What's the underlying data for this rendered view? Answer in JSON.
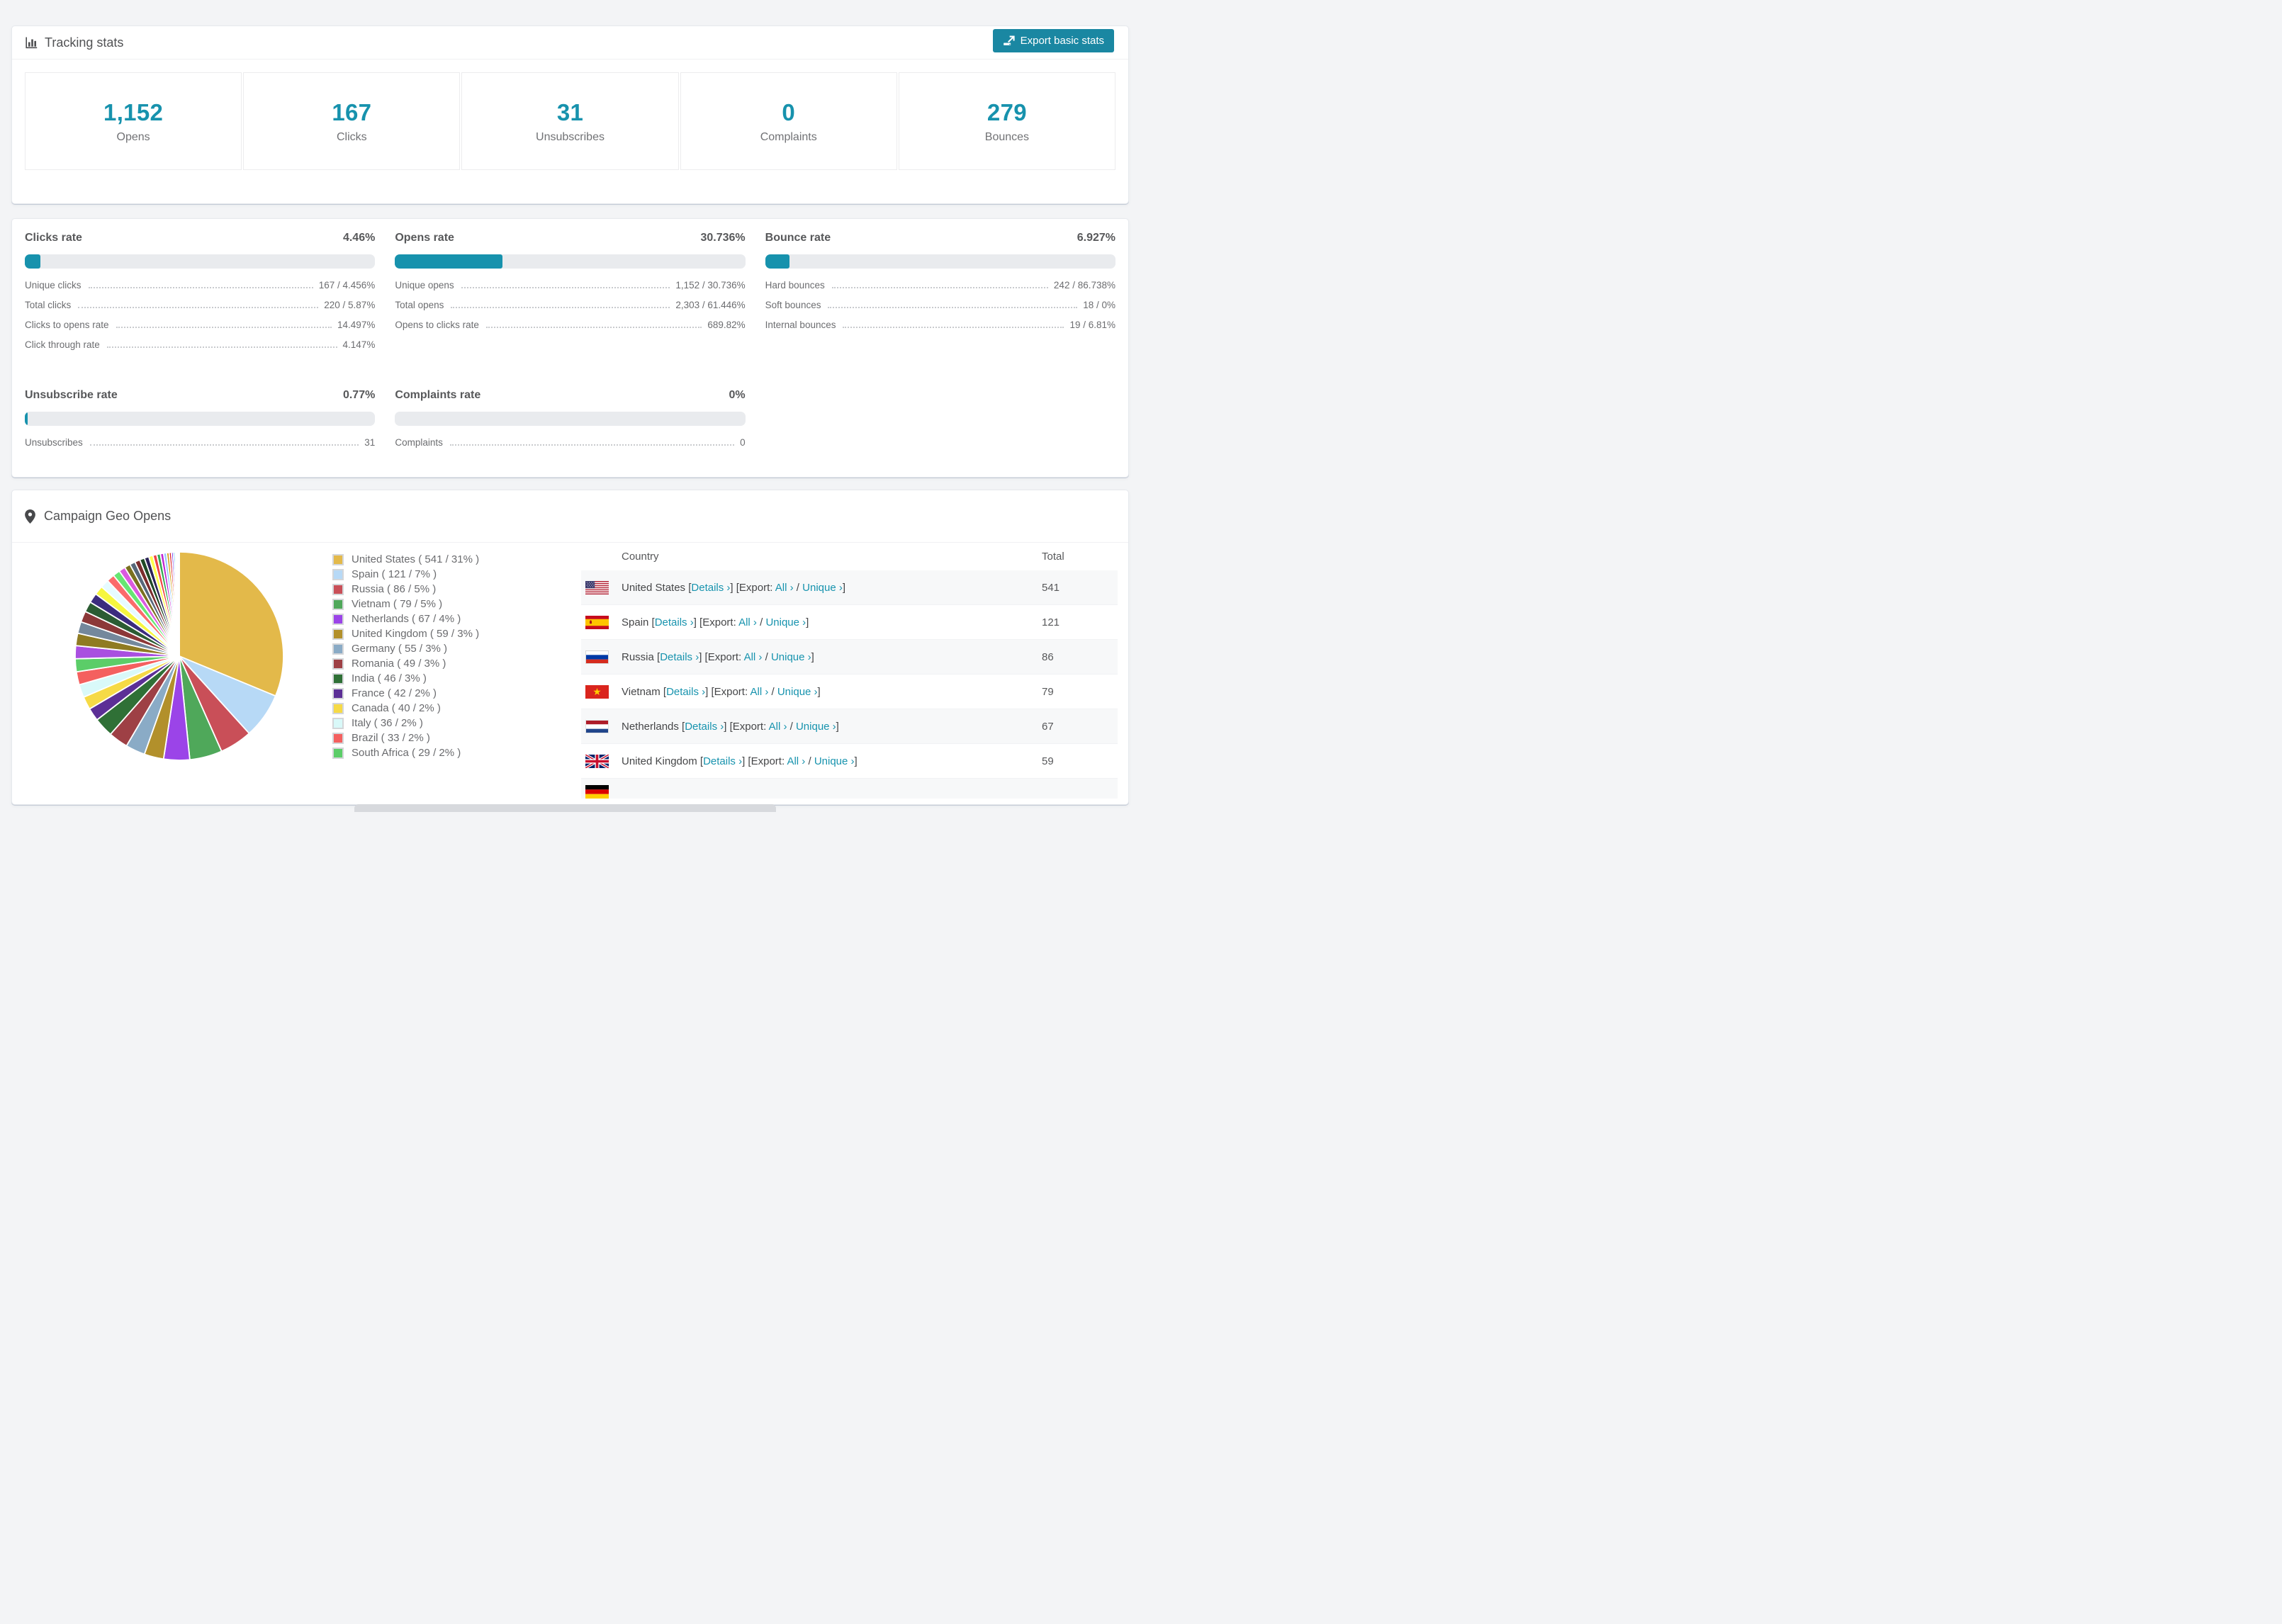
{
  "header": {
    "title": "Tracking stats",
    "export_button": "Export basic stats"
  },
  "stats": [
    {
      "value": "1,152",
      "label": "Opens"
    },
    {
      "value": "167",
      "label": "Clicks"
    },
    {
      "value": "31",
      "label": "Unsubscribes"
    },
    {
      "value": "0",
      "label": "Complaints"
    },
    {
      "value": "279",
      "label": "Bounces"
    }
  ],
  "rates": {
    "clicks": {
      "title": "Clicks rate",
      "value": "4.46%",
      "bar_pct": 4.46,
      "items": [
        [
          "Unique clicks",
          "167 / 4.456%"
        ],
        [
          "Total clicks",
          "220 / 5.87%"
        ],
        [
          "Clicks to opens rate",
          "14.497%"
        ],
        [
          "Click through rate",
          "4.147%"
        ]
      ]
    },
    "opens": {
      "title": "Opens rate",
      "value": "30.736%",
      "bar_pct": 30.736,
      "items": [
        [
          "Unique opens",
          "1,152 / 30.736%"
        ],
        [
          "Total opens",
          "2,303 / 61.446%"
        ],
        [
          "Opens to clicks rate",
          "689.82%"
        ]
      ]
    },
    "bounce": {
      "title": "Bounce rate",
      "value": "6.927%",
      "bar_pct": 6.927,
      "items": [
        [
          "Hard bounces",
          "242 / 86.738%"
        ],
        [
          "Soft bounces",
          "18 / 0%"
        ],
        [
          "Internal bounces",
          "19 / 6.81%"
        ]
      ]
    },
    "unsubscribe": {
      "title": "Unsubscribe rate",
      "value": "0.77%",
      "bar_pct": 0.77,
      "items": [
        [
          "Unsubscribes",
          "31"
        ]
      ]
    },
    "complaints": {
      "title": "Complaints rate",
      "value": "0%",
      "bar_pct": 0,
      "items": [
        [
          "Complaints",
          "0"
        ]
      ]
    }
  },
  "geo": {
    "title": "Campaign Geo Opens",
    "table": {
      "columns": [
        "Country",
        "Total"
      ],
      "link_labels": {
        "details": "Details ›",
        "export": "Export:",
        "all": "All ›",
        "unique": "Unique ›"
      },
      "rows": [
        {
          "flag": "us",
          "country": "United States",
          "total": "541"
        },
        {
          "flag": "es",
          "country": "Spain",
          "total": "121"
        },
        {
          "flag": "ru",
          "country": "Russia",
          "total": "86"
        },
        {
          "flag": "vn",
          "country": "Vietnam",
          "total": "79"
        },
        {
          "flag": "nl",
          "country": "Netherlands",
          "total": "67"
        },
        {
          "flag": "gb",
          "country": "United Kingdom",
          "total": "59"
        },
        {
          "flag": "de",
          "country": "",
          "total": "",
          "partial": true
        }
      ]
    }
  },
  "chart_data": {
    "type": "pie",
    "title": "Campaign Geo Opens",
    "legend_position": "right",
    "slices": [
      {
        "label": "United States",
        "count": 541,
        "pct": 31,
        "color": "#e3b94a"
      },
      {
        "label": "Spain",
        "count": 121,
        "pct": 7,
        "color": "#b7d9f6"
      },
      {
        "label": "Russia",
        "count": 86,
        "pct": 5,
        "color": "#c94f58"
      },
      {
        "label": "Vietnam",
        "count": 79,
        "pct": 5,
        "color": "#4fa85a"
      },
      {
        "label": "Netherlands",
        "count": 67,
        "pct": 4,
        "color": "#9b44e8"
      },
      {
        "label": "United Kingdom",
        "count": 59,
        "pct": 3,
        "color": "#b2902b"
      },
      {
        "label": "Germany",
        "count": 55,
        "pct": 3,
        "color": "#8aabc6"
      },
      {
        "label": "Romania",
        "count": 49,
        "pct": 3,
        "color": "#9e4045"
      },
      {
        "label": "India",
        "count": 46,
        "pct": 3,
        "color": "#2f7036"
      },
      {
        "label": "France",
        "count": 42,
        "pct": 2,
        "color": "#5c2f96"
      },
      {
        "label": "Canada",
        "count": 40,
        "pct": 2,
        "color": "#f6da46"
      },
      {
        "label": "Italy",
        "count": 36,
        "pct": 2,
        "color": "#d9f9f9"
      },
      {
        "label": "Brazil",
        "count": 33,
        "pct": 2,
        "color": "#f4605f"
      },
      {
        "label": "South Africa",
        "count": 29,
        "pct": 2,
        "color": "#5bcd68"
      }
    ],
    "small_unlabeled_slices": {
      "values": [
        2.0,
        1.9,
        1.8,
        1.7,
        1.6,
        1.5,
        1.4,
        1.3,
        1.2,
        1.1,
        1.0,
        0.9,
        0.85,
        0.8,
        0.75,
        0.7,
        0.65,
        0.6,
        0.55,
        0.5,
        0.45,
        0.4,
        0.35,
        0.3,
        0.25,
        0.2,
        0.15,
        0.12,
        0.1,
        0.08
      ],
      "colors": [
        "#a94fe0",
        "#8f7b22",
        "#74889c",
        "#8c3838",
        "#2b5c33",
        "#3b2c7e",
        "#f6f63f",
        "#e6fbff",
        "#fb6b6b",
        "#66e673",
        "#da5be0",
        "#7a701f",
        "#56687a",
        "#7b2d2d",
        "#1f4a26",
        "#2b2357",
        "#ffff4d",
        "#ef4444",
        "#34a853",
        "#c026d3",
        "#93c5fd",
        "#d4a017",
        "#dc2626",
        "#7c3aed",
        "#0ea5e9",
        "#a3e635",
        "#f472b6",
        "#713f12",
        "#0f766e",
        "#94a3b8"
      ]
    }
  },
  "colors": {
    "accent": "#1792ad",
    "link": "#1793ae",
    "bar_track": "#e9ebee",
    "button": "#1a87a2"
  }
}
